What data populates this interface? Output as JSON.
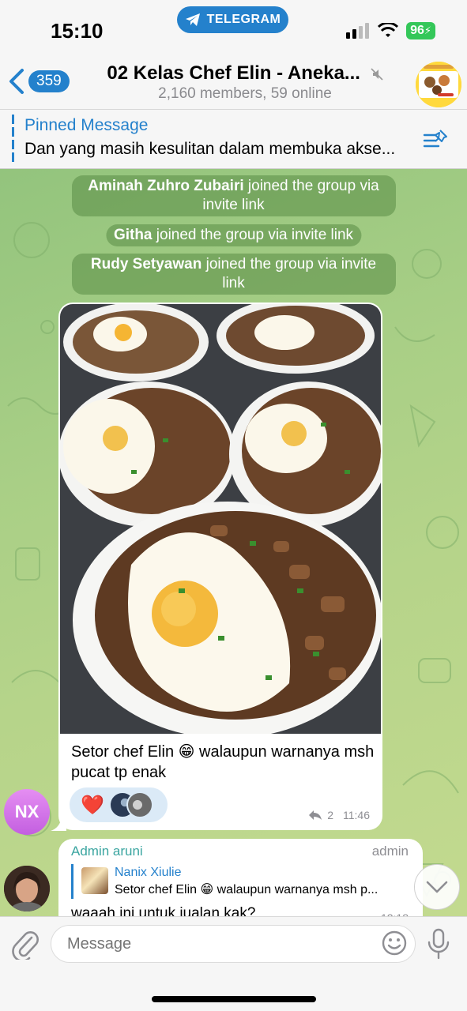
{
  "status_bar": {
    "time": "15:10",
    "app_pill": "TELEGRAM",
    "battery": "96"
  },
  "header": {
    "back_count": "359",
    "title": "02 Kelas Chef Elin - Aneka...",
    "subtitle": "2,160 members, 59 online"
  },
  "pinned": {
    "title": "Pinned Message",
    "text": "Dan yang masih kesulitan dalam membuka akse..."
  },
  "service_messages": [
    {
      "name": "Aminah Zuhro Zubairi",
      "text": " joined the group via invite link"
    },
    {
      "name": "Githa",
      "text": " joined the group via invite link"
    },
    {
      "name": "Rudy Setyawan",
      "text": " joined the group via invite link"
    }
  ],
  "media_message": {
    "caption": "Setor chef Elin 😁 walaupun warnanya msh pucat tp enak",
    "reaction_emoji": "❤️",
    "forward_count": "2",
    "time": "11:46",
    "sender_initials": "NX"
  },
  "reply_message": {
    "sender": "Admin aruni",
    "role": "admin",
    "quote_name": "Nanix Xiulie",
    "quote_text": "Setor chef Elin 😁 walaupun warnanya msh p...",
    "body": "waaah ini untuk jualan kak?",
    "time": "12:18"
  },
  "input": {
    "placeholder": "Message"
  },
  "colors": {
    "accent": "#2481cc",
    "battery": "#34c759",
    "reaction_bg": "#dbeaf7"
  }
}
